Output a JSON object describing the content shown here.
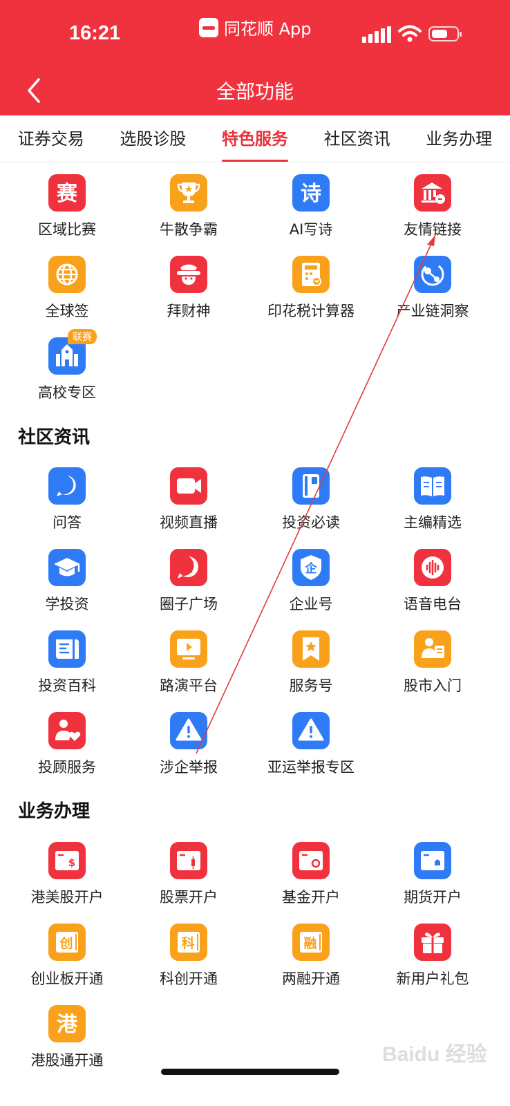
{
  "status": {
    "time": "16:21",
    "app": "同花顺 App"
  },
  "nav": {
    "title": "全部功能"
  },
  "tabs": [
    {
      "label": "证券交易"
    },
    {
      "label": "选股诊股"
    },
    {
      "label": "特色服务"
    },
    {
      "label": "社区资讯"
    },
    {
      "label": "业务办理"
    }
  ],
  "special": [
    {
      "label": "区域比赛",
      "icon": "sai-char-icon",
      "color": "#f0323e"
    },
    {
      "label": "牛散争霸",
      "icon": "trophy-icon",
      "color": "#f9a11b"
    },
    {
      "label": "AI写诗",
      "icon": "shi-char-icon",
      "color": "#2f7bf5"
    },
    {
      "label": "友情链接",
      "icon": "bank-link-icon",
      "color": "#f0323e"
    },
    {
      "label": "全球签",
      "icon": "globe-icon",
      "color": "#f9a11b"
    },
    {
      "label": "拜财神",
      "icon": "fortune-god-icon",
      "color": "#f0323e"
    },
    {
      "label": "印花税计算器",
      "icon": "calculator-icon",
      "color": "#f9a11b"
    },
    {
      "label": "产业链洞察",
      "icon": "industry-chain-icon",
      "color": "#2f7bf5"
    },
    {
      "label": "高校专区",
      "icon": "university-icon",
      "color": "#2f7bf5",
      "badge": "联赛"
    }
  ],
  "sections": {
    "community": "社区资讯",
    "business": "业务办理"
  },
  "community": [
    {
      "label": "问答",
      "icon": "question-icon",
      "color": "#2f7bf5"
    },
    {
      "label": "视频直播",
      "icon": "video-camera-icon",
      "color": "#f0323e"
    },
    {
      "label": "投资必读",
      "icon": "book-icon",
      "color": "#2f7bf5"
    },
    {
      "label": "主编精选",
      "icon": "open-book-icon",
      "color": "#2f7bf5"
    },
    {
      "label": "学投资",
      "icon": "graduation-cap-icon",
      "color": "#2f7bf5"
    },
    {
      "label": "圈子广场",
      "icon": "star-bubble-icon",
      "color": "#f0323e"
    },
    {
      "label": "企业号",
      "icon": "enterprise-shield-icon",
      "color": "#2f7bf5"
    },
    {
      "label": "语音电台",
      "icon": "voice-wave-icon",
      "color": "#f0323e"
    },
    {
      "label": "投资百科",
      "icon": "encyclopedia-icon",
      "color": "#2f7bf5"
    },
    {
      "label": "路演平台",
      "icon": "play-screen-icon",
      "color": "#f9a11b"
    },
    {
      "label": "服务号",
      "icon": "bookmark-star-icon",
      "color": "#f9a11b"
    },
    {
      "label": "股市入门",
      "icon": "reader-icon",
      "color": "#f9a11b"
    },
    {
      "label": "投顾服务",
      "icon": "advisor-heart-icon",
      "color": "#f0323e"
    },
    {
      "label": "涉企举报",
      "icon": "warning-icon",
      "color": "#2f7bf5"
    },
    {
      "label": "亚运举报专区",
      "icon": "warning-icon",
      "color": "#2f7bf5"
    }
  ],
  "business": [
    {
      "label": "港美股开户",
      "icon": "card-dollar-icon",
      "color": "#f0323e"
    },
    {
      "label": "股票开户",
      "icon": "card-stock-icon",
      "color": "#f0323e"
    },
    {
      "label": "基金开户",
      "icon": "card-fund-icon",
      "color": "#f0323e"
    },
    {
      "label": "期货开户",
      "icon": "card-futures-icon",
      "color": "#2f7bf5"
    },
    {
      "label": "创业板开通",
      "icon": "chuang-char-icon",
      "color": "#f9a11b"
    },
    {
      "label": "科创开通",
      "icon": "ke-char-icon",
      "color": "#f9a11b"
    },
    {
      "label": "两融开通",
      "icon": "rong-char-icon",
      "color": "#f9a11b"
    },
    {
      "label": "新用户礼包",
      "icon": "gift-icon",
      "color": "#f0323e"
    },
    {
      "label": "港股通开通",
      "icon": "gang-char-icon",
      "color": "#f9a11b"
    }
  ],
  "watermark": "Baidu 经验"
}
